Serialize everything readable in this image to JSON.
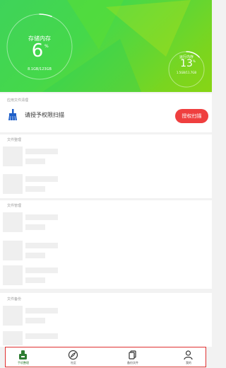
{
  "storage": {
    "label": "存储内存",
    "percent": "6",
    "unit": "%",
    "usage": "8.1GB/123GB",
    "fraction": 0.06
  },
  "memory": {
    "label": "运行内存",
    "percent": "13",
    "unit": "%",
    "usage": "1.5GB/11.7GB",
    "fraction": 0.13
  },
  "cleanup": {
    "title": "应用文件清理",
    "prompt": "请授予权限扫描",
    "button": "授权扫描"
  },
  "sections": {
    "doc_title": "文件整理",
    "recent_title": "文件管理",
    "backup_title": "文件备份"
  },
  "tabs": [
    {
      "label": "手机整理",
      "icon": "phone-clean-icon"
    },
    {
      "label": "社区",
      "icon": "compass-icon"
    },
    {
      "label": "备份文件",
      "icon": "copy-files-icon"
    },
    {
      "label": "我的",
      "icon": "person-icon"
    }
  ],
  "colors": {
    "accent": "#45d84a",
    "button": "#ef3f3f",
    "tab_active": "#2e7d32"
  }
}
